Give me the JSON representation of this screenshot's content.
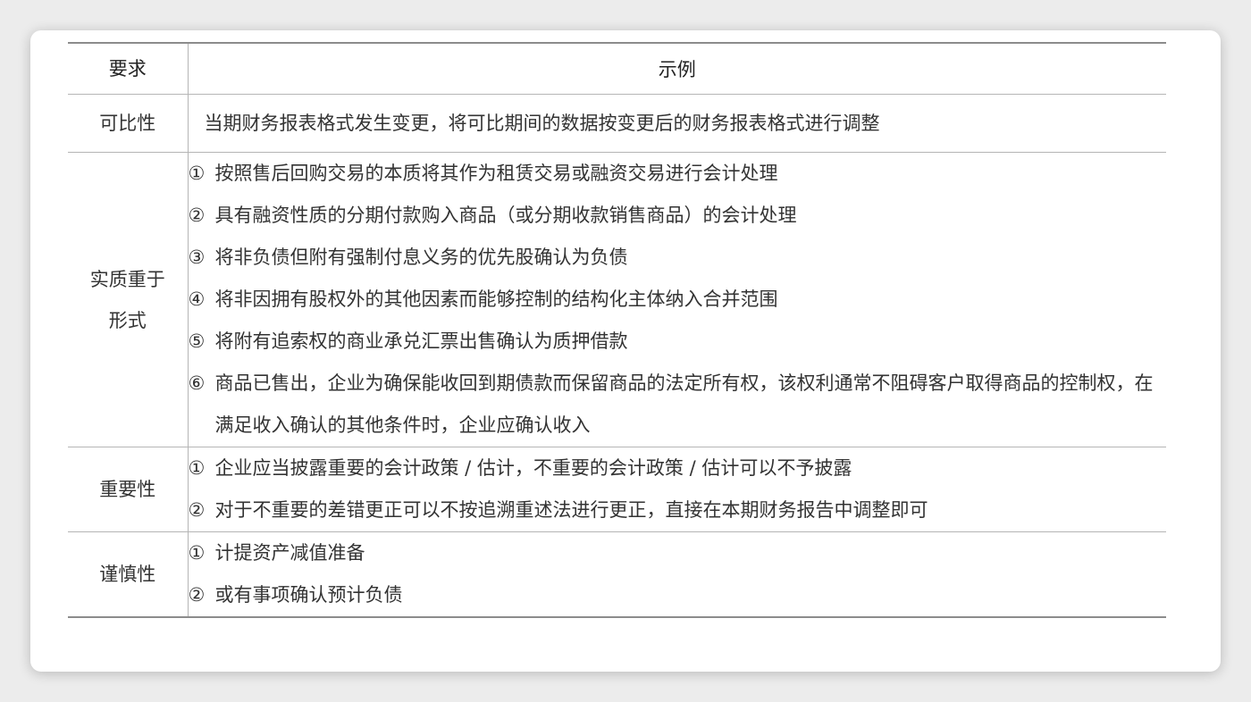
{
  "table": {
    "headers": [
      "要求",
      "示例"
    ],
    "rows": [
      {
        "requirement": "可比性",
        "examples": [
          {
            "marker": "",
            "text": "当期财务报表格式发生变更，将可比期间的数据按变更后的财务报表格式进行调整"
          }
        ]
      },
      {
        "requirement": [
          "实质重于",
          "形式"
        ],
        "examples": [
          {
            "marker": "①",
            "text": "按照售后回购交易的本质将其作为租赁交易或融资交易进行会计处理"
          },
          {
            "marker": "②",
            "text": "具有融资性质的分期付款购入商品（或分期收款销售商品）的会计处理"
          },
          {
            "marker": "③",
            "text": "将非负债但附有强制付息义务的优先股确认为负债"
          },
          {
            "marker": "④",
            "text": "将非因拥有股权外的其他因素而能够控制的结构化主体纳入合并范围"
          },
          {
            "marker": "⑤",
            "text": "将附有追索权的商业承兑汇票出售确认为质押借款"
          },
          {
            "marker": "⑥",
            "text": "商品已售出，企业为确保能收回到期债款而保留商品的法定所有权，该权利通常不阻碍客户取得商品的控制权，在满足收入确认的其他条件时，企业应确认收入"
          }
        ]
      },
      {
        "requirement": "重要性",
        "examples": [
          {
            "marker": "①",
            "text": "企业应当披露重要的会计政策 / 估计，不重要的会计政策 / 估计可以不予披露"
          },
          {
            "marker": "②",
            "text": "对于不重要的差错更正可以不按追溯重述法进行更正，直接在本期财务报告中调整即可"
          }
        ]
      },
      {
        "requirement": "谨慎性",
        "examples": [
          {
            "marker": "①",
            "text": "计提资产减值准备"
          },
          {
            "marker": "②",
            "text": "或有事项确认预计负债"
          }
        ]
      }
    ]
  }
}
